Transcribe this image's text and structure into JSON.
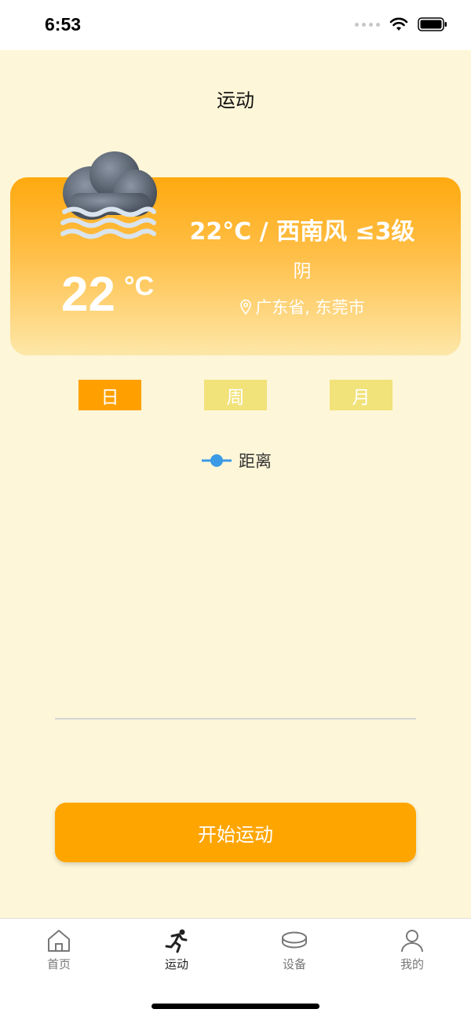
{
  "status_bar": {
    "time": "6:53"
  },
  "header": {
    "title": "运动"
  },
  "weather": {
    "temperature": "22",
    "unit": "°C",
    "summary": "22°C / 西南风 ≤3级",
    "condition": "阴",
    "location": "广东省, 东莞市",
    "icon": "cloudy-fog-icon"
  },
  "period_tabs": [
    {
      "label": "日",
      "active": true
    },
    {
      "label": "周",
      "active": false
    },
    {
      "label": "月",
      "active": false
    }
  ],
  "chart": {
    "legend_label": "距离",
    "legend_color": "#3a9ae6"
  },
  "actions": {
    "start_label": "开始运动",
    "start_color": "#ffa500"
  },
  "tab_bar": {
    "items": [
      {
        "label": "首页",
        "icon": "home-icon"
      },
      {
        "label": "运动",
        "icon": "running-icon",
        "active": true
      },
      {
        "label": "设备",
        "icon": "device-icon"
      },
      {
        "label": "我的",
        "icon": "user-icon"
      }
    ]
  },
  "colors": {
    "accent": "#ffa000",
    "background": "#fdf6d8",
    "inactive_tab": "#f2e27a"
  }
}
